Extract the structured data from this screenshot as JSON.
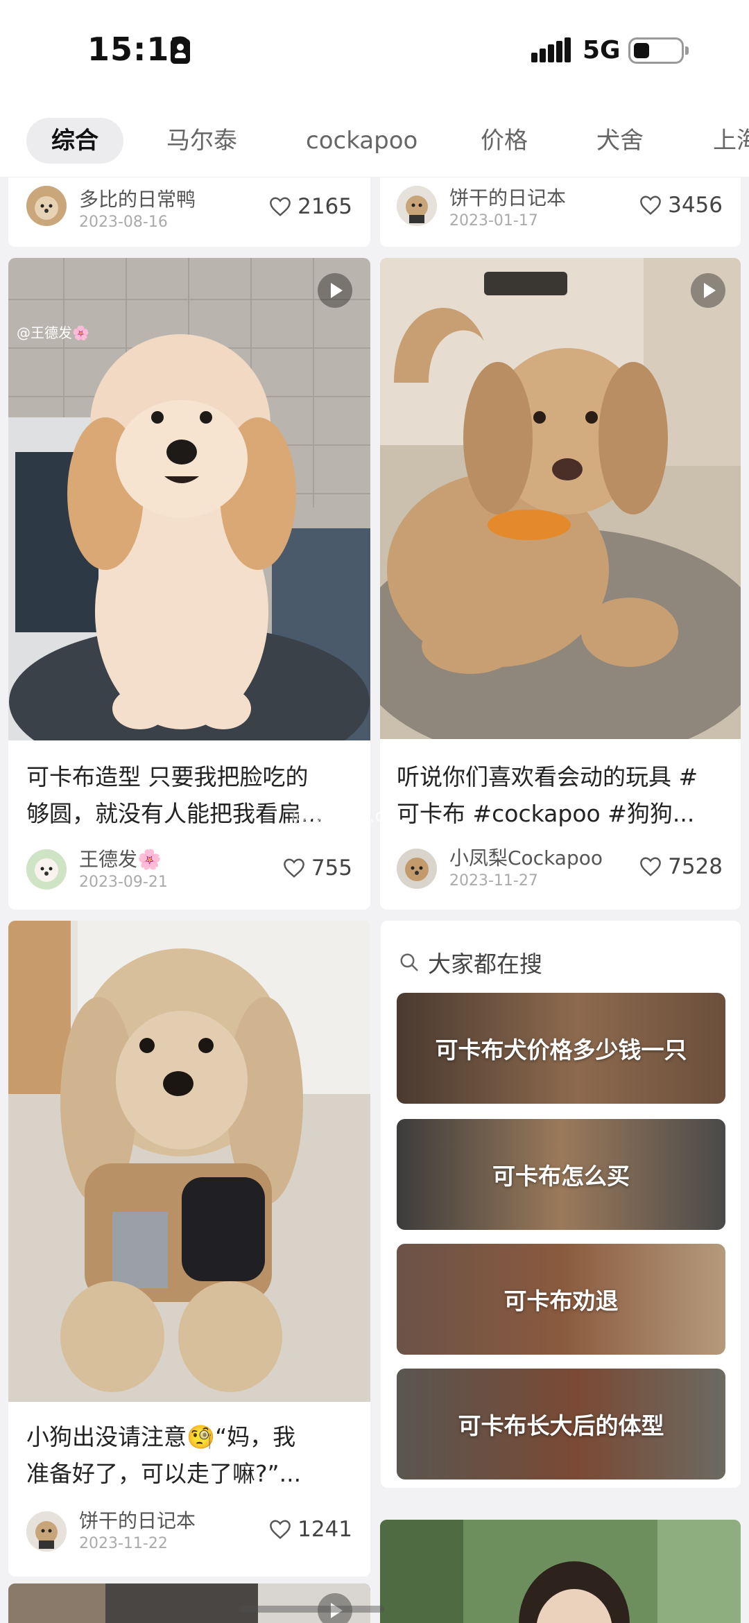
{
  "status": {
    "time": "15:12",
    "network": "5G"
  },
  "tabs": [
    "综合",
    "马尔泰",
    "cockapoo",
    "价格",
    "犬舍",
    "上海"
  ],
  "top_cards": [
    {
      "author": "多比的日常鸭",
      "date": "2023-08-16",
      "likes": "2165"
    },
    {
      "author": "饼干的日记本",
      "date": "2023-01-17",
      "likes": "3456"
    }
  ],
  "posts": [
    {
      "title_line1": "可卡布造型 只要我把脸吃的",
      "title_line2": "够圆，就没有人能把我看扁...",
      "author": "王德发🌸",
      "date": "2023-09-21",
      "likes": "755",
      "img_tag": "@王德发🌸"
    },
    {
      "title_line1": "听说你们喜欢看会动的玩具 #",
      "title_line2": "可卡布 #cockapoo #狗狗...",
      "author": "小凤梨Cockapoo",
      "date": "2023-11-27",
      "likes": "7528"
    },
    {
      "title_line1": "小狗出没请注意🧐“妈，我",
      "title_line2": "准备好了，可以走了嘛?”...",
      "author": "饼干的日记本",
      "date": "2023-11-22",
      "likes": "1241"
    }
  ],
  "search": {
    "heading": "大家都在搜",
    "suggestions": [
      "可卡布犬价格多少钱一只",
      "可卡布怎么买",
      "可卡布劝退",
      "可卡布长大后的体型"
    ]
  },
  "watermark": "@粉色的..c"
}
